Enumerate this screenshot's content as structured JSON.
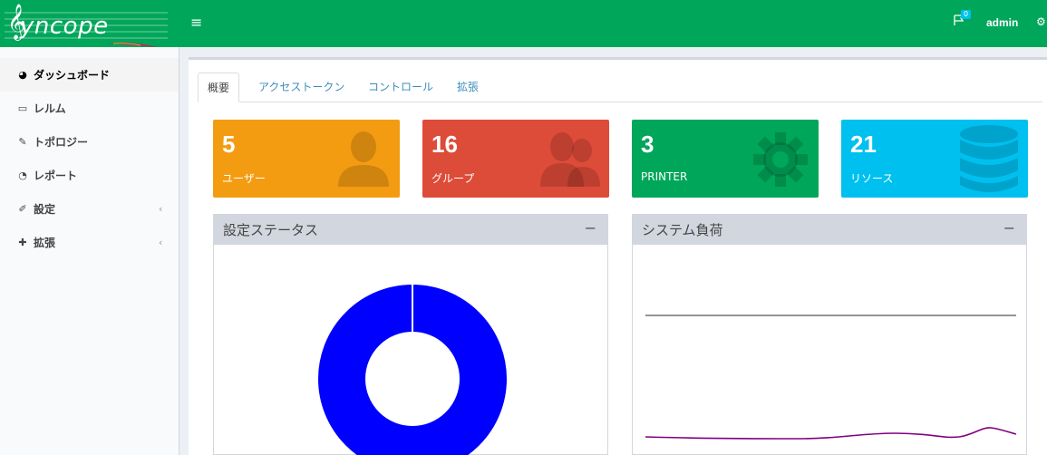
{
  "app": {
    "logo_text": "yncope",
    "logo_clef": "𝄞"
  },
  "header": {
    "menu_icon": "hamburger-icon",
    "notif_count": "0",
    "user_name": "admin"
  },
  "sidebar": {
    "items": [
      {
        "label": "ダッシュボード",
        "icon": "dashboard-icon"
      },
      {
        "label": "レルム",
        "icon": "folder-icon"
      },
      {
        "label": "トポロジー",
        "icon": "plug-icon"
      },
      {
        "label": "レポート",
        "icon": "pie-icon"
      },
      {
        "label": "設定",
        "icon": "edit-icon"
      },
      {
        "label": "拡張",
        "icon": "puzzle-icon"
      }
    ]
  },
  "tabs": [
    "概要",
    "アクセストークン",
    "コントロール",
    "拡張"
  ],
  "tiles": [
    {
      "value": "5",
      "label": "ユーザー",
      "color": "#f39c12"
    },
    {
      "value": "16",
      "label": "グループ",
      "color": "#dd4b39"
    },
    {
      "value": "3",
      "label": "PRINTER",
      "color": "#00a65a"
    },
    {
      "value": "21",
      "label": "リソース",
      "color": "#00c0ef"
    }
  ],
  "panels": {
    "config_status": {
      "title": "設定ステータス",
      "collapse": "−"
    },
    "system_load": {
      "title": "システム負荷",
      "collapse": "−"
    }
  },
  "colors": {
    "brand": "#00a65a",
    "donut": "#0000ff",
    "flat_line": "#555555",
    "load_line": "#800080"
  }
}
